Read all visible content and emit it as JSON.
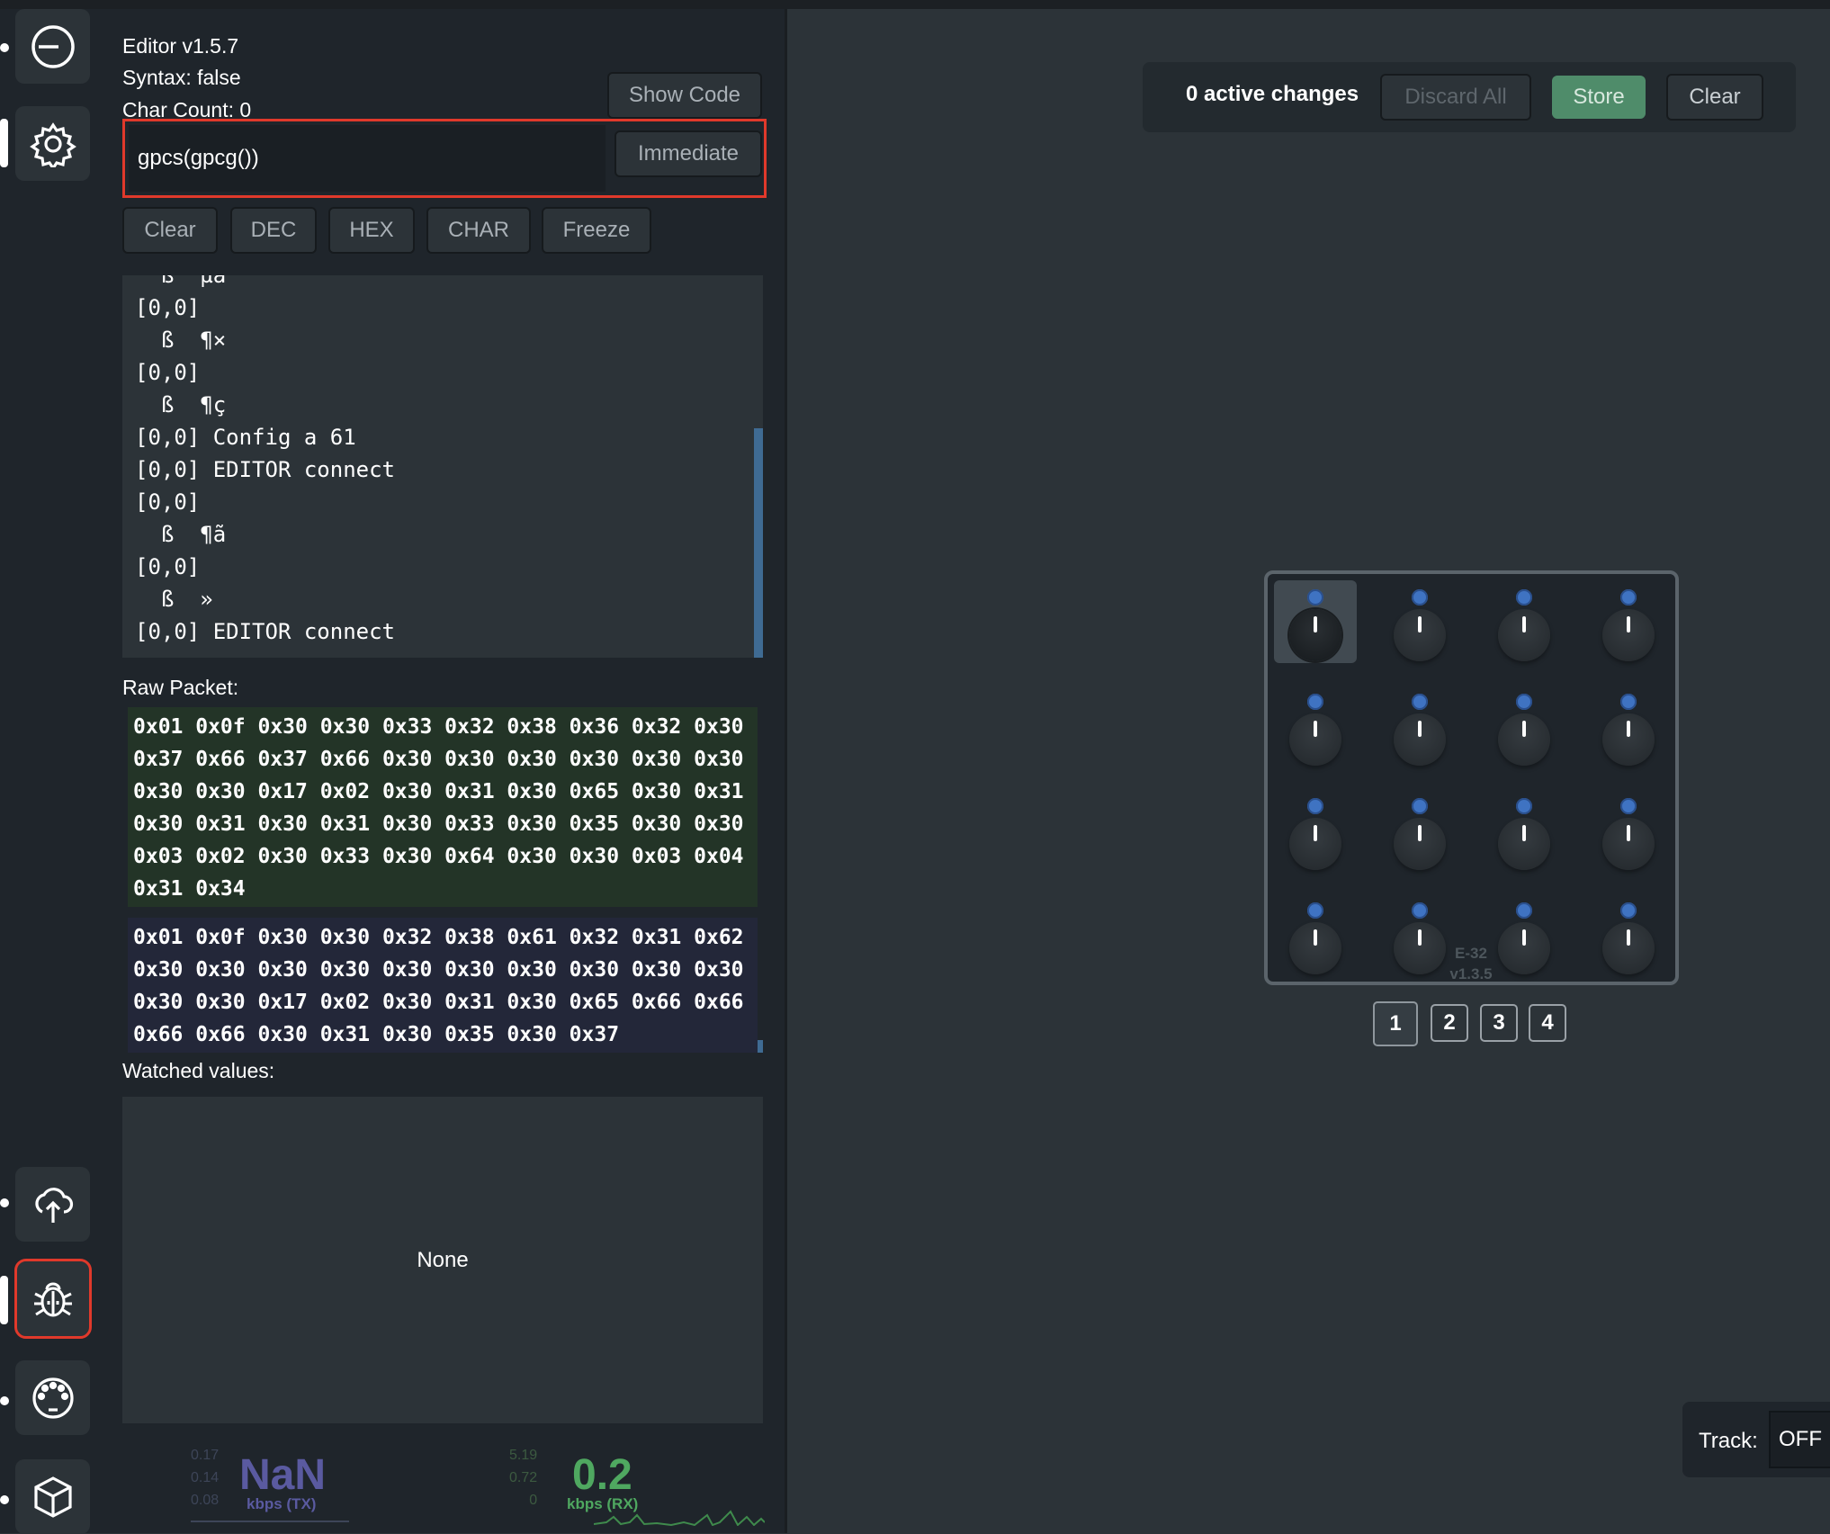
{
  "editor": {
    "version": "Editor v1.5.7",
    "syntax": "Syntax: false",
    "char_count": "Char Count:  0",
    "show_code_label": "Show Code",
    "code_value": "gpcs(gpcg())",
    "immediate_label": "Immediate"
  },
  "console": {
    "buttons": [
      "Clear",
      "DEC",
      "HEX",
      "CHAR",
      "Freeze"
    ],
    "lines": [
      "  ß  µa",
      "[0,0]",
      "  ß  ¶×",
      "[0,0]",
      "  ß  ¶ç",
      "[0,0] Config a 61",
      "[0,0] EDITOR connect",
      "[0,0]",
      "  ß  ¶ã",
      "[0,0]",
      "  ß  »",
      "[0,0] EDITOR connect"
    ]
  },
  "raw_packet": {
    "label": "Raw Packet:",
    "packet1": "0x01 0x0f 0x30 0x30 0x33 0x32 0x38 0x36 0x32 0x30 0x37 0x66 0x37 0x66 0x30 0x30 0x30 0x30 0x30 0x30 0x30 0x30 0x17 0x02 0x30 0x31 0x30 0x65 0x30 0x31 0x30 0x31 0x30 0x31 0x30 0x33 0x30 0x35 0x30 0x30 0x03 0x02 0x30 0x33 0x30 0x64 0x30 0x30 0x03 0x04 0x31 0x34",
    "packet2": "0x01 0x0f 0x30 0x30 0x32 0x38 0x61 0x32 0x31 0x62 0x30 0x30 0x30 0x30 0x30 0x30 0x30 0x30 0x30 0x30 0x30 0x30 0x17 0x02 0x30 0x31 0x30 0x65 0x66 0x66 0x66 0x66 0x30 0x31 0x30 0x35 0x30 0x37"
  },
  "watched": {
    "label": "Watched values:",
    "value": "None"
  },
  "stats": {
    "tx": {
      "ticks": [
        "0.17",
        "0.14",
        "0.08"
      ],
      "value": "NaN",
      "unit": "kbps (TX)"
    },
    "rx": {
      "ticks": [
        "5.19",
        "0.72",
        "0"
      ],
      "value": "0.2",
      "unit": "kbps (RX)"
    }
  },
  "toolbar": {
    "changes": "0 active changes",
    "discard_label": "Discard All",
    "store_label": "Store",
    "clear_label": "Clear"
  },
  "device": {
    "name": "E-32",
    "version": "v1.3.5",
    "selected_knob": 1
  },
  "pages": [
    "1",
    "2",
    "3",
    "4"
  ],
  "active_page": "1",
  "track": {
    "label": "Track:",
    "value": "OFF"
  },
  "colors": {
    "accent_green": "#4f8c6a",
    "highlight_red": "#e0392b",
    "led_blue": "#3f73c2",
    "tx_purple": "#5a5aa0",
    "rx_green": "#4fa860"
  }
}
